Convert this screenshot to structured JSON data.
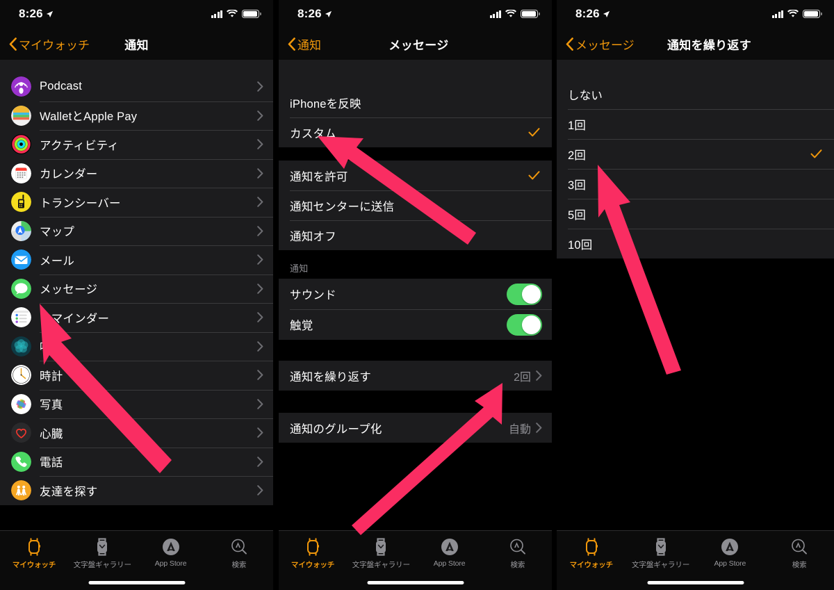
{
  "accent": "#f0970b",
  "arrow_color": "#fa2d62",
  "toggle_on_color": "#4cd464",
  "status_bar": {
    "time": "8:26",
    "location_icon": "location-arrow-icon",
    "signal_icon": "cellular-signal-icon",
    "wifi_icon": "wifi-icon",
    "battery_icon": "battery-full-icon"
  },
  "tabs": [
    {
      "label": "マイウォッチ",
      "icon": "apple-watch-icon",
      "active": true
    },
    {
      "label": "文字盤ギャラリー",
      "icon": "watch-face-gallery-icon",
      "active": false
    },
    {
      "label": "App Store",
      "icon": "app-store-icon",
      "active": false
    },
    {
      "label": "検索",
      "icon": "search-icon",
      "active": false
    }
  ],
  "panel1": {
    "nav": {
      "back_label": "マイウォッチ",
      "title": "通知"
    },
    "apps": [
      {
        "name": "Podcast",
        "icon": "podcast-icon"
      },
      {
        "name": "WalletとApple Pay",
        "icon": "wallet-icon"
      },
      {
        "name": "アクティビティ",
        "icon": "activity-rings-icon"
      },
      {
        "name": "カレンダー",
        "icon": "calendar-icon"
      },
      {
        "name": "トランシーバー",
        "icon": "walkie-talkie-icon"
      },
      {
        "name": "マップ",
        "icon": "maps-icon"
      },
      {
        "name": "メール",
        "icon": "mail-icon"
      },
      {
        "name": "メッセージ",
        "icon": "messages-icon"
      },
      {
        "name": "リマインダー",
        "icon": "reminders-icon"
      },
      {
        "name": "呼吸",
        "icon": "breathe-icon"
      },
      {
        "name": "時計",
        "icon": "clock-icon"
      },
      {
        "name": "写真",
        "icon": "photos-icon"
      },
      {
        "name": "心臓",
        "icon": "heart-rate-icon"
      },
      {
        "name": "電話",
        "icon": "phone-icon"
      },
      {
        "name": "友達を探す",
        "icon": "find-friends-icon"
      }
    ]
  },
  "panel2": {
    "nav": {
      "back_label": "通知",
      "title": "メッセージ"
    },
    "mirror_group": [
      {
        "label": "iPhoneを反映",
        "checked": false
      },
      {
        "label": "カスタム",
        "checked": true
      }
    ],
    "alert_group": [
      {
        "label": "通知を許可",
        "checked": true
      },
      {
        "label": "通知センターに送信",
        "checked": false
      },
      {
        "label": "通知オフ",
        "checked": false
      }
    ],
    "section_header": "通知",
    "toggle_group": [
      {
        "label": "サウンド",
        "on": true
      },
      {
        "label": "触覚",
        "on": true
      }
    ],
    "repeat_row": {
      "label": "通知を繰り返す",
      "value": "2回"
    },
    "group_row": {
      "label": "通知のグループ化",
      "value": "自動"
    }
  },
  "panel3": {
    "nav": {
      "back_label": "メッセージ",
      "title": "通知を繰り返す"
    },
    "options": [
      {
        "label": "しない",
        "checked": false
      },
      {
        "label": "1回",
        "checked": false
      },
      {
        "label": "2回",
        "checked": true
      },
      {
        "label": "3回",
        "checked": false
      },
      {
        "label": "5回",
        "checked": false
      },
      {
        "label": "10回",
        "checked": false
      }
    ]
  }
}
